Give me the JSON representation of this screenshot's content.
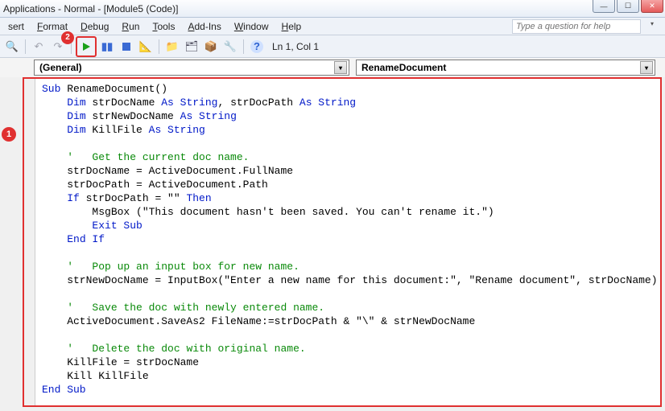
{
  "window": {
    "title": "Applications - Normal - [Module5 (Code)]"
  },
  "menu": {
    "insert": "sert",
    "format": "Format",
    "debug": "Debug",
    "run": "Run",
    "tools": "Tools",
    "addins": "Add-Ins",
    "window": "Window",
    "help": "Help"
  },
  "help_placeholder": "Type a question for help",
  "toolbar": {
    "position": "Ln 1, Col 1"
  },
  "dropdowns": {
    "object": "(General)",
    "procedure": "RenameDocument"
  },
  "annotations": {
    "step1": "1",
    "step2": "2"
  },
  "code": {
    "l1_a": "Sub",
    "l1_b": " RenameDocument()",
    "l2_a": "    ",
    "l2_b": "Dim",
    "l2_c": " strDocName ",
    "l2_d": "As String",
    "l2_e": ", strDocPath ",
    "l2_f": "As String",
    "l3_a": "    ",
    "l3_b": "Dim",
    "l3_c": " strNewDocName ",
    "l3_d": "As String",
    "l4_a": "    ",
    "l4_b": "Dim",
    "l4_c": " KillFile ",
    "l4_d": "As String",
    "l5": "",
    "l6_a": "    ",
    "l6_b": "'   Get the current doc name.",
    "l7": "    strDocName = ActiveDocument.FullName",
    "l8": "    strDocPath = ActiveDocument.Path",
    "l9_a": "    ",
    "l9_b": "If",
    "l9_c": " strDocPath = \"\" ",
    "l9_d": "Then",
    "l10": "        MsgBox (\"This document hasn't been saved. You can't rename it.\")",
    "l11_a": "        ",
    "l11_b": "Exit Sub",
    "l12_a": "    ",
    "l12_b": "End If",
    "l13": "",
    "l14_a": "    ",
    "l14_b": "'   Pop up an input box for new name.",
    "l15": "    strNewDocName = InputBox(\"Enter a new name for this document:\", \"Rename document\", strDocName)",
    "l16": "",
    "l17_a": "    ",
    "l17_b": "'   Save the doc with newly entered name.",
    "l18": "    ActiveDocument.SaveAs2 FileName:=strDocPath & \"\\\" & strNewDocName",
    "l19": "",
    "l20_a": "    ",
    "l20_b": "'   Delete the doc with original name.",
    "l21": "    KillFile = strDocName",
    "l22": "    Kill KillFile",
    "l23": "End Sub"
  }
}
